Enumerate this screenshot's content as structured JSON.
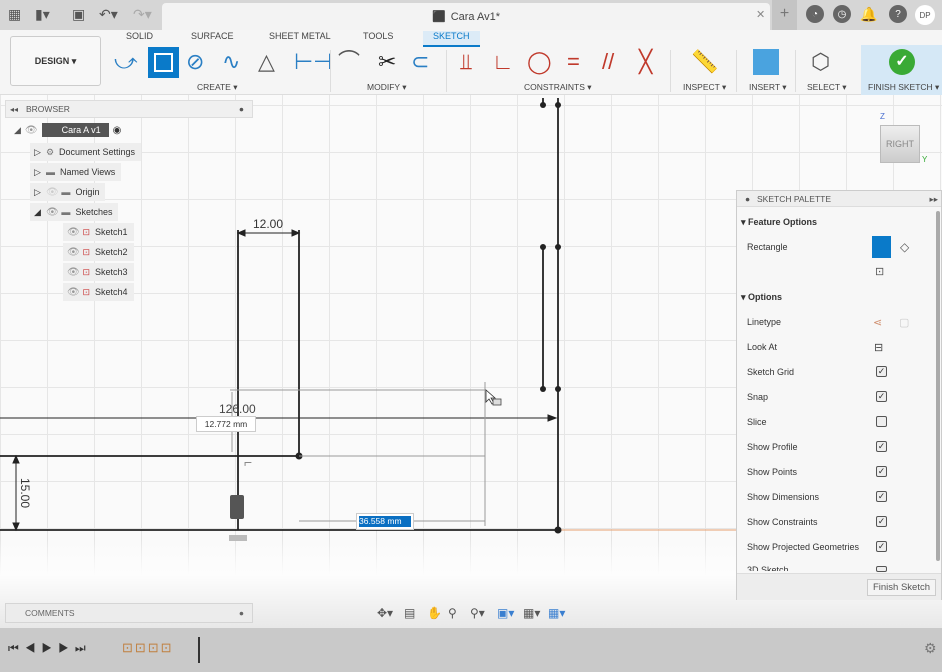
{
  "title_bar": {
    "document_title": "Cara Av1*",
    "user_initials": "DP",
    "icons": [
      "grid-icon",
      "file-icon",
      "save-icon",
      "undo-icon",
      "redo-icon",
      "close-icon",
      "plus-icon",
      "extensions-icon",
      "job-status-icon",
      "notifications-icon",
      "help-icon"
    ]
  },
  "toolbar": {
    "workspace": "DESIGN ▾",
    "tabs": [
      "SOLID",
      "SURFACE",
      "SHEET METAL",
      "TOOLS",
      "SKETCH"
    ],
    "active_tab": "SKETCH",
    "groups": {
      "create": "CREATE ▾",
      "modify": "MODIFY ▾",
      "constraints": "CONSTRAINTS ▾",
      "inspect": "INSPECT ▾",
      "insert": "INSERT ▾",
      "select": "SELECT ▾",
      "finish": "FINISH SKETCH ▾"
    },
    "accent": "#0a7ac9",
    "finish_color": "#3aaa35"
  },
  "browser": {
    "title": "BROWSER",
    "root": "Cara A v1",
    "items": [
      {
        "label": "Document Settings"
      },
      {
        "label": "Named Views"
      },
      {
        "label": "Origin"
      },
      {
        "label": "Sketches"
      }
    ],
    "sketches": [
      "Sketch1",
      "Sketch2",
      "Sketch3",
      "Sketch4"
    ]
  },
  "sketch": {
    "dim_width": "12.00",
    "dim_long": "126.00",
    "dim_height": "15.00",
    "input_vertical": "12.772 mm",
    "input_horizontal": "36.558 mm"
  },
  "viewcube": {
    "face": "RIGHT",
    "axis_z": "Z",
    "axis_y": "Y"
  },
  "palette": {
    "title": "SKETCH PALETTE",
    "feature_options": "Feature Options",
    "rectangle": "Rectangle",
    "options": "Options",
    "rows": [
      {
        "label": "Linetype"
      },
      {
        "label": "Look At"
      },
      {
        "label": "Sketch Grid",
        "checked": true
      },
      {
        "label": "Snap",
        "checked": true
      },
      {
        "label": "Slice",
        "checked": false
      },
      {
        "label": "Show Profile",
        "checked": true
      },
      {
        "label": "Show Points",
        "checked": true
      },
      {
        "label": "Show Dimensions",
        "checked": true
      },
      {
        "label": "Show Constraints",
        "checked": true
      },
      {
        "label": "Show Projected Geometries",
        "checked": true
      },
      {
        "label": "3D Sketch",
        "checked": false
      }
    ],
    "finish_button": "Finish Sketch"
  },
  "comments": {
    "title": "COMMENTS"
  }
}
